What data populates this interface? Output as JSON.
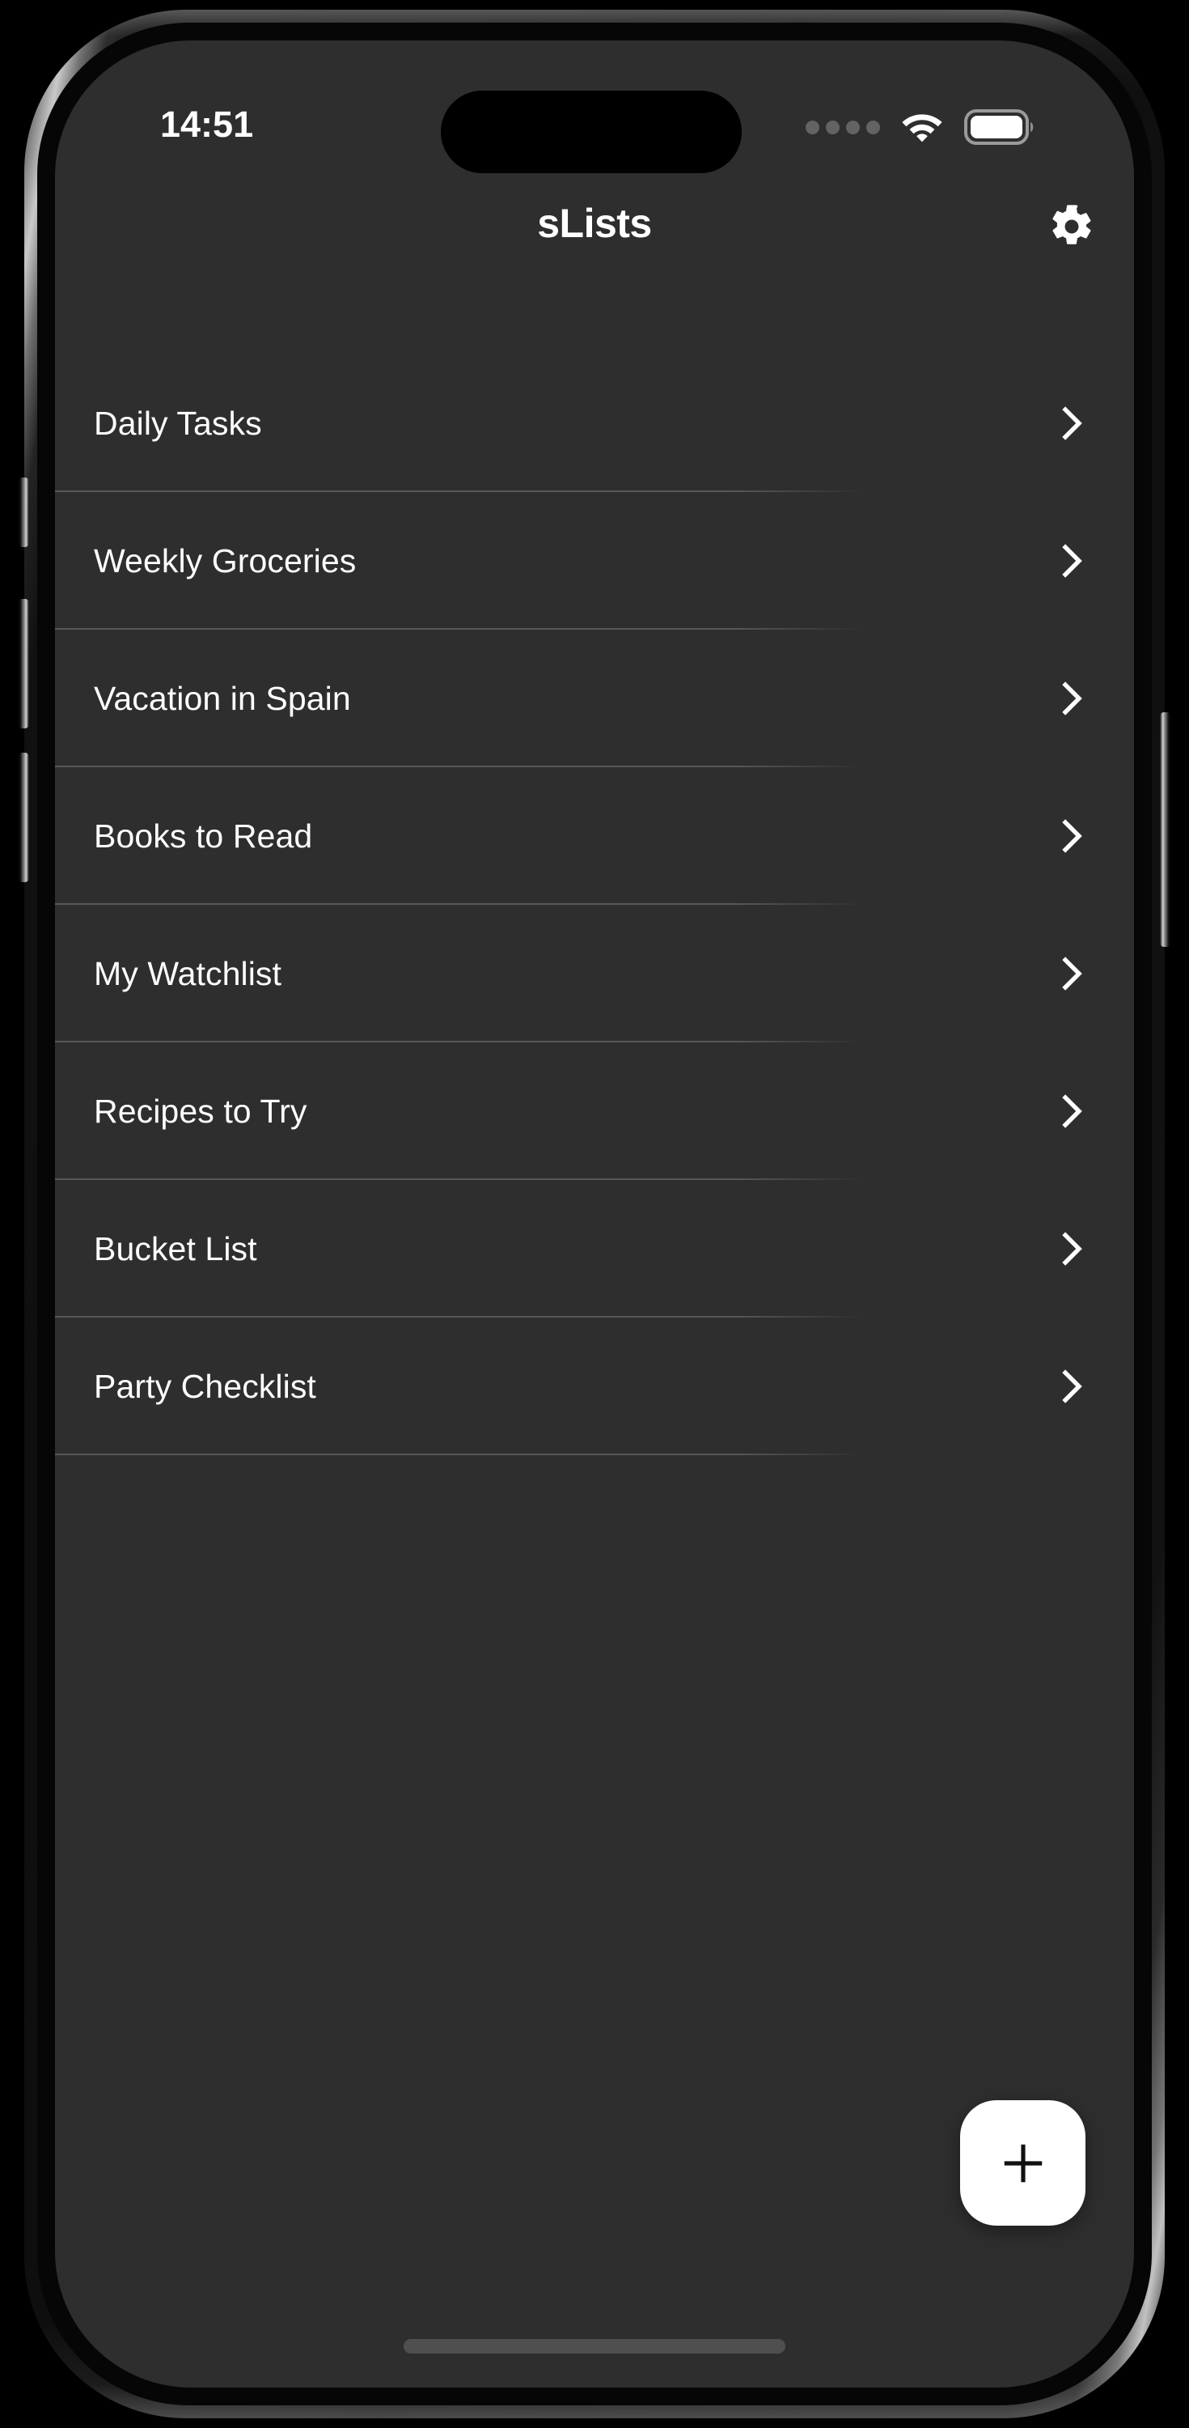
{
  "status_bar": {
    "time": "14:51",
    "cellular_icon": "cellular-dots-icon",
    "wifi_icon": "wifi-icon",
    "battery_icon": "battery-full-icon",
    "dynamic_island": "dynamic-island"
  },
  "header": {
    "title": "sLists",
    "settings_icon": "gear-icon"
  },
  "lists": [
    {
      "label": "Daily Tasks",
      "chevron": "chevron-right-icon"
    },
    {
      "label": "Weekly Groceries",
      "chevron": "chevron-right-icon"
    },
    {
      "label": "Vacation in Spain",
      "chevron": "chevron-right-icon"
    },
    {
      "label": "Books to Read",
      "chevron": "chevron-right-icon"
    },
    {
      "label": "My Watchlist",
      "chevron": "chevron-right-icon"
    },
    {
      "label": "Recipes to Try",
      "chevron": "chevron-right-icon"
    },
    {
      "label": "Bucket List",
      "chevron": "chevron-right-icon"
    },
    {
      "label": "Party Checklist",
      "chevron": "chevron-right-icon"
    }
  ],
  "fab": {
    "icon": "plus-icon",
    "label": "+"
  },
  "colors": {
    "screen_background": "#2e2e2e",
    "text_primary": "#ffffff",
    "divider": "rgba(255,255,255,0.20)",
    "fab_background": "#ffffff",
    "fab_icon": "#111111",
    "status_dim": "#636363",
    "home_indicator": "#4f4f4f"
  }
}
